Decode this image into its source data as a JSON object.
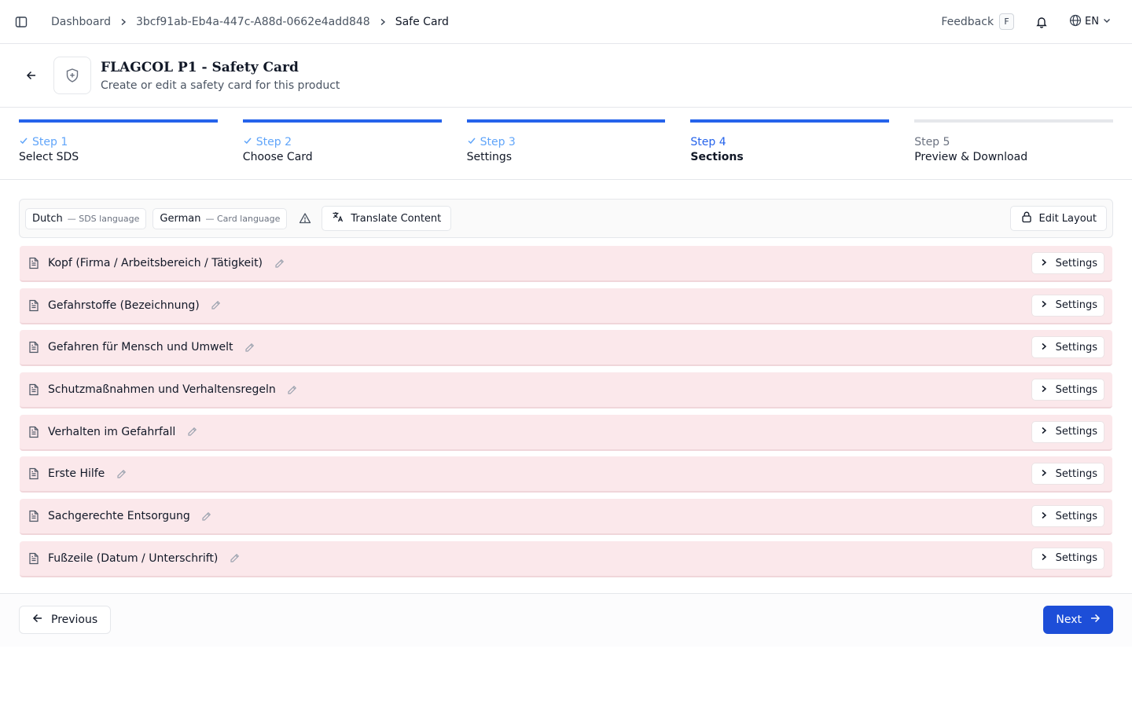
{
  "breadcrumb": {
    "items": [
      "Dashboard",
      "3bcf91ab-Eb4a-447c-A88d-0662e4add848",
      "Safe Card"
    ]
  },
  "topbar": {
    "feedback_label": "Feedback",
    "feedback_shortcut": "F",
    "language": "EN"
  },
  "header": {
    "title": "FLAGCOL P1 - Safety Card",
    "subtitle": "Create or edit a safety card for this product"
  },
  "steps": [
    {
      "number": "Step 1",
      "label": "Select SDS",
      "state": "done"
    },
    {
      "number": "Step 2",
      "label": "Choose Card",
      "state": "done"
    },
    {
      "number": "Step 3",
      "label": "Settings",
      "state": "done"
    },
    {
      "number": "Step 4",
      "label": "Sections",
      "state": "active"
    },
    {
      "number": "Step 5",
      "label": "Preview & Download",
      "state": "pending"
    }
  ],
  "toolbar": {
    "sds_language": "Dutch",
    "sds_language_hint": "— SDS language",
    "card_language": "German",
    "card_language_hint": "— Card language",
    "translate_label": "Translate Content",
    "edit_layout_label": "Edit Layout"
  },
  "sections": [
    {
      "name": "Kopf (Firma / Arbeitsbereich / Tätigkeit)",
      "settings_label": "Settings"
    },
    {
      "name": "Gefahrstoffe (Bezeichnung)",
      "settings_label": "Settings"
    },
    {
      "name": "Gefahren für Mensch und Umwelt",
      "settings_label": "Settings"
    },
    {
      "name": "Schutzmaßnahmen und Verhaltensregeln",
      "settings_label": "Settings"
    },
    {
      "name": "Verhalten im Gefahrfall",
      "settings_label": "Settings"
    },
    {
      "name": "Erste Hilfe",
      "settings_label": "Settings"
    },
    {
      "name": "Sachgerechte Entsorgung",
      "settings_label": "Settings"
    },
    {
      "name": "Fußzeile (Datum / Unterschrift)",
      "settings_label": "Settings"
    }
  ],
  "footer": {
    "previous_label": "Previous",
    "next_label": "Next"
  },
  "colors": {
    "accent": "#2563eb",
    "section_background": "#fbe8eb",
    "primary_button": "#1d4ed8"
  },
  "icons": {
    "sidebar": "sidebar-toggle-icon",
    "bell": "bell-icon",
    "globe": "globe-icon",
    "shield": "shield-plus-icon",
    "document": "document-icon",
    "pencil": "pencil-icon",
    "warning": "warning-triangle-icon",
    "translate": "translate-icon",
    "lock": "lock-icon"
  }
}
